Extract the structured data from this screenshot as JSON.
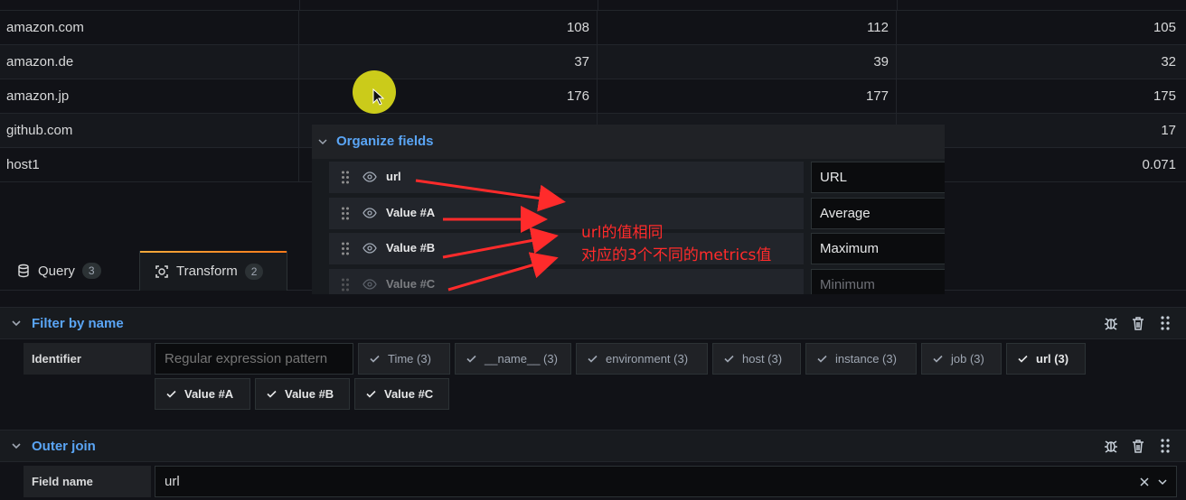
{
  "table": {
    "rows": [
      {
        "name": "amazon.com",
        "a": "108",
        "b": "112",
        "c": "105"
      },
      {
        "name": "amazon.de",
        "a": "37",
        "b": "39",
        "c": "32"
      },
      {
        "name": "amazon.jp",
        "a": "176",
        "b": "177",
        "c": "175"
      },
      {
        "name": "github.com",
        "a": "",
        "b": "",
        "c": "17"
      },
      {
        "name": "host1",
        "a": "",
        "b": "",
        "c": "0.071"
      }
    ]
  },
  "tabs": [
    {
      "label": "Query",
      "count": "3",
      "icon": "database-icon"
    },
    {
      "label": "Transform",
      "count": "2",
      "icon": "transform-icon"
    }
  ],
  "organize": {
    "title": "Organize fields",
    "fields": [
      {
        "name": "url",
        "rename": "URL"
      },
      {
        "name": "Value #A",
        "rename": "Average"
      },
      {
        "name": "Value #B",
        "rename": "Maximum"
      },
      {
        "name": "Value #C",
        "rename": "Minimum"
      }
    ]
  },
  "annotation": {
    "line1": "url的值相同",
    "line2": "对应的3个不同的metrics值"
  },
  "filter_by_name": {
    "title": "Filter by name",
    "identifier_label": "Identifier",
    "regex_placeholder": "Regular expression pattern",
    "chips": [
      {
        "label": "Time (3)",
        "selected": false
      },
      {
        "label": "__name__ (3)",
        "selected": false
      },
      {
        "label": "environment (3)",
        "selected": false
      },
      {
        "label": "host (3)",
        "selected": false
      },
      {
        "label": "instance (3)",
        "selected": false
      },
      {
        "label": "job (3)",
        "selected": false
      },
      {
        "label": "url (3)",
        "selected": true
      },
      {
        "label": "Value #A",
        "selected": true
      },
      {
        "label": "Value #B",
        "selected": true
      },
      {
        "label": "Value #C",
        "selected": true
      }
    ]
  },
  "outer_join": {
    "title": "Outer join",
    "field_label": "Field name",
    "field_value": "url"
  },
  "colors": {
    "accent_blue": "#5aa5f5",
    "tab_underline": "#ff7a1a",
    "annotation_red": "#ff2b2b",
    "cursor_highlight": "#d6d61a"
  }
}
